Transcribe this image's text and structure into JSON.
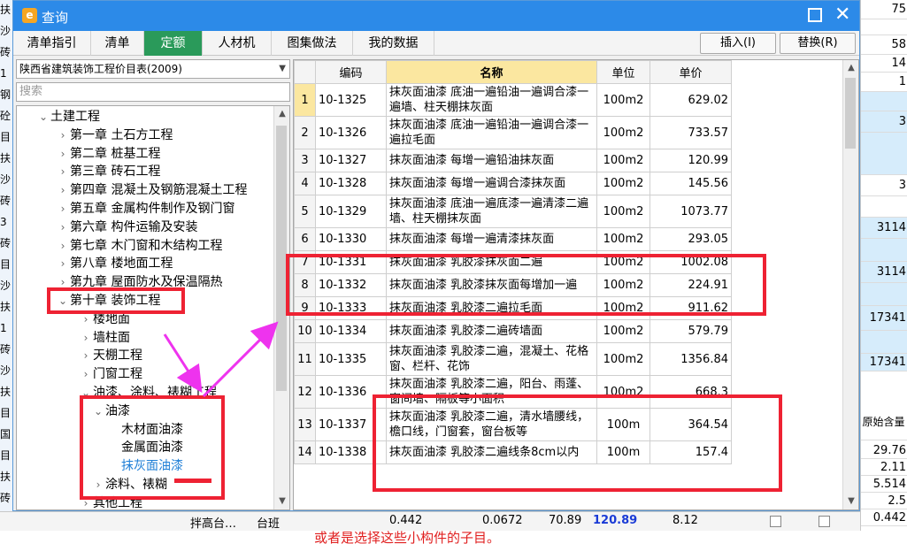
{
  "background": {
    "left_strip_chars": [
      "扶",
      "沙",
      "砖",
      "1",
      "钢",
      "砼",
      "目",
      "扶",
      "沙",
      "砖",
      "3",
      "砖",
      "目",
      "沙",
      "扶",
      "1",
      "砖",
      "沙",
      "扶",
      "目",
      "国",
      "目",
      "扶",
      "砖"
    ],
    "right_col_values": [
      "75",
      "",
      "58",
      "14",
      "1",
      "",
      "3",
      "",
      "3",
      "",
      "3114",
      "",
      "3114",
      "",
      "17341",
      "",
      "17341"
    ],
    "right_header": "原始含量",
    "right_values_bottom": [
      "29.76",
      "2.11",
      "5.514",
      "2.5",
      "0.442"
    ],
    "bottom_row": {
      "name": "拌高台…",
      "unit": "台班",
      "v1": "0.442",
      "v2": "0.0672",
      "v3": "70.89",
      "v4": "120.89",
      "v5": "8.12",
      "v6": "0.442"
    },
    "caption": "或者是选择这些小构件的子目。"
  },
  "dialog": {
    "title": "查询",
    "tabs": [
      {
        "label": "清单指引"
      },
      {
        "label": "清单"
      },
      {
        "label": "定额"
      },
      {
        "label": "人材机"
      },
      {
        "label": "图集做法"
      },
      {
        "label": "我的数据"
      }
    ],
    "active_tab": "定额",
    "insert_label": "插入(I)",
    "replace_label": "替换(R)",
    "library": "陕西省建筑装饰工程价目表(2009)",
    "search_placeholder": "搜索"
  },
  "tree": [
    {
      "label": "土建工程",
      "level": 0,
      "expanded": true
    },
    {
      "label": "第一章  土石方工程",
      "level": 1
    },
    {
      "label": "第二章  桩基工程",
      "level": 1
    },
    {
      "label": "第三章  砖石工程",
      "level": 1
    },
    {
      "label": "第四章  混凝土及钢筋混凝土工程",
      "level": 1
    },
    {
      "label": "第五章  金属构件制作及钢门窗",
      "level": 1
    },
    {
      "label": "第六章  构件运输及安装",
      "level": 1
    },
    {
      "label": "第七章  木门窗和木结构工程",
      "level": 1
    },
    {
      "label": "第八章  楼地面工程",
      "level": 1
    },
    {
      "label": "第九章  屋面防水及保温隔热",
      "level": 1
    },
    {
      "label": "第十章  装饰工程",
      "level": 1,
      "expanded": true
    },
    {
      "label": "楼地面",
      "level": 2
    },
    {
      "label": "墙柱面",
      "level": 2
    },
    {
      "label": "天棚工程",
      "level": 2
    },
    {
      "label": "门窗工程",
      "level": 2
    },
    {
      "label": "油漆、涂料、裱糊工程",
      "level": 2,
      "expanded": true
    },
    {
      "label": "油漆",
      "level": 3,
      "expanded": true
    },
    {
      "label": "木材面油漆",
      "level": 4
    },
    {
      "label": "金属面油漆",
      "level": 4
    },
    {
      "label": "抹灰面油漆",
      "level": 4,
      "selected": true
    },
    {
      "label": "涂料、裱糊",
      "level": 3
    },
    {
      "label": "其他工程",
      "level": 2
    }
  ],
  "table": {
    "headers": {
      "code": "编码",
      "name": "名称",
      "unit": "单位",
      "price": "单价"
    },
    "rows": [
      {
        "idx": "1",
        "code": "10-1325",
        "name": "抹灰面油漆 底油一遍铅油一遍调合漆一遍墙、柱天棚抹灰面",
        "unit": "100m2",
        "price": "629.02"
      },
      {
        "idx": "2",
        "code": "10-1326",
        "name": "抹灰面油漆 底油一遍铅油一遍调合漆一遍拉毛面",
        "unit": "100m2",
        "price": "733.57"
      },
      {
        "idx": "3",
        "code": "10-1327",
        "name": "抹灰面油漆 每增一遍铅油抹灰面",
        "unit": "100m2",
        "price": "120.99"
      },
      {
        "idx": "4",
        "code": "10-1328",
        "name": "抹灰面油漆 每增一遍调合漆抹灰面",
        "unit": "100m2",
        "price": "145.56"
      },
      {
        "idx": "5",
        "code": "10-1329",
        "name": "抹灰面油漆 底油一遍底漆一遍清漆二遍墙、柱天棚抹灰面",
        "unit": "100m2",
        "price": "1073.77"
      },
      {
        "idx": "6",
        "code": "10-1330",
        "name": "抹灰面油漆 每增一遍清漆抹灰面",
        "unit": "100m2",
        "price": "293.05"
      },
      {
        "idx": "7",
        "code": "10-1331",
        "name": "抹灰面油漆 乳胶漆抹灰面二遍",
        "unit": "100m2",
        "price": "1002.08"
      },
      {
        "idx": "8",
        "code": "10-1332",
        "name": "抹灰面油漆 乳胶漆抹灰面每增加一遍",
        "unit": "100m2",
        "price": "224.91"
      },
      {
        "idx": "9",
        "code": "10-1333",
        "name": "抹灰面油漆 乳胶漆二遍拉毛面",
        "unit": "100m2",
        "price": "911.62"
      },
      {
        "idx": "10",
        "code": "10-1334",
        "name": "抹灰面油漆 乳胶漆二遍砖墙面",
        "unit": "100m2",
        "price": "579.79"
      },
      {
        "idx": "11",
        "code": "10-1335",
        "name": "抹灰面油漆 乳胶漆二遍，混凝土、花格窗、栏杆、花饰",
        "unit": "100m2",
        "price": "1356.84"
      },
      {
        "idx": "12",
        "code": "10-1336",
        "name": "抹灰面油漆 乳胶漆二遍，阳台、雨蓬、窗间墙、隔板等小面积",
        "unit": "100m2",
        "price": "668.3"
      },
      {
        "idx": "13",
        "code": "10-1337",
        "name": "抹灰面油漆 乳胶漆二遍，清水墙腰线，檐口线，门窗套，窗台板等",
        "unit": "100m",
        "price": "364.54"
      },
      {
        "idx": "14",
        "code": "10-1338",
        "name": "抹灰面油漆 乳胶漆二遍线条8cm以内",
        "unit": "100m",
        "price": "157.4"
      }
    ]
  },
  "colors": {
    "titlebar": "#2c8ae8",
    "active_tab": "#2a9a5a",
    "annotation_box": "#ee2233",
    "annotation_arrow": "#ee33ee",
    "caption": "#e02020"
  }
}
